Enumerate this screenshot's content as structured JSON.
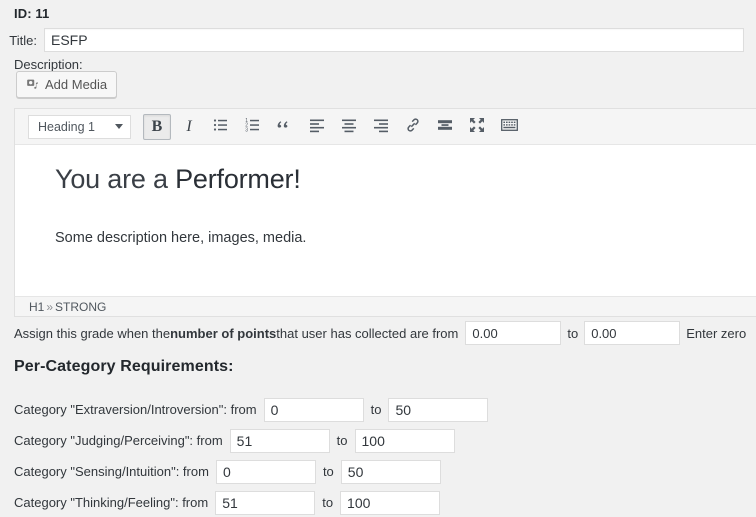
{
  "record": {
    "id_label": "ID: 11"
  },
  "title_field": {
    "label": "Title:",
    "value": "ESFP",
    "placeholder": ""
  },
  "description": {
    "label": "Description:",
    "add_media_button": "Add Media",
    "add_media_icon": "media-icon"
  },
  "editor": {
    "toolbar": {
      "format_select": {
        "value": "Heading 1",
        "caret_icon": "chevron-down-icon"
      },
      "buttons": [
        {
          "name": "bold-button",
          "icon": "bold-icon",
          "label": "B",
          "active": true
        },
        {
          "name": "italic-button",
          "icon": "italic-icon",
          "label": "I",
          "active": false
        },
        {
          "name": "bullet-list-button",
          "icon": "bulleted-list-icon",
          "label": "",
          "active": false
        },
        {
          "name": "numbered-list-button",
          "icon": "numbered-list-icon",
          "label": "",
          "active": false
        },
        {
          "name": "blockquote-button",
          "icon": "blockquote-icon",
          "label": "“",
          "active": false
        },
        {
          "name": "align-left-button",
          "icon": "align-left-icon",
          "label": "",
          "active": false
        },
        {
          "name": "align-center-button",
          "icon": "align-center-icon",
          "label": "",
          "active": false
        },
        {
          "name": "align-right-button",
          "icon": "align-right-icon",
          "label": "",
          "active": false
        },
        {
          "name": "insert-link-button",
          "icon": "link-icon",
          "label": "",
          "active": false
        },
        {
          "name": "read-more-button",
          "icon": "read-more-icon",
          "label": "",
          "active": false
        },
        {
          "name": "distraction-free-button",
          "icon": "fullscreen-icon",
          "label": "",
          "active": false
        },
        {
          "name": "keyboard-shortcuts-button",
          "icon": "keyboard-icon",
          "label": "",
          "active": false
        }
      ]
    },
    "content": {
      "heading_prefix": "You are a ",
      "heading_strong": "Performer!",
      "paragraph": "Some description here, images, media."
    },
    "path_bar": {
      "first": "H1",
      "separator": "»",
      "second": "STRONG"
    }
  },
  "grade_rule": {
    "text_before_bold": "Assign this grade when the ",
    "bold_text": "number of points",
    "text_after_bold": " that user has collected are from",
    "to_label": "to",
    "from_value": "0.00",
    "to_value": "0.00",
    "trailing_text": "Enter zero"
  },
  "per_category": {
    "heading": "Per-Category Requirements:",
    "from_label_suffix": ": from",
    "to_label": "to",
    "rows": [
      {
        "label": "Category \"Extraversion/Introversion\": from",
        "from": "0",
        "to": "50"
      },
      {
        "label": "Category \"Judging/Perceiving\": from",
        "from": "51",
        "to": "100"
      },
      {
        "label": "Category \"Sensing/Intuition\": from",
        "from": "0",
        "to": "50"
      },
      {
        "label": "Category \"Thinking/Feeling\": from",
        "from": "51",
        "to": "100"
      }
    ]
  },
  "colors": {
    "page_bg": "#f1f1f1",
    "panel_bg": "#ffffff",
    "toolbar_bg": "#f5f5f5",
    "border": "#e0e0e0",
    "input_border": "#dddddd",
    "text": "#32373c",
    "icon": "#555d66"
  }
}
